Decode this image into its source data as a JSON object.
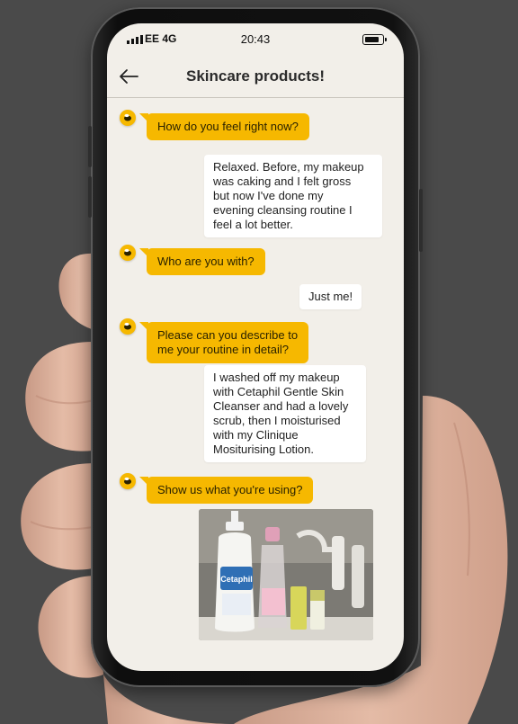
{
  "status": {
    "carrier": "EE 4G",
    "time": "20:43"
  },
  "header": {
    "title": "Skincare products!"
  },
  "messages": [
    {
      "from": "bot",
      "text": "How do you feel right now?"
    },
    {
      "from": "user",
      "lines": [
        "Relaxed. Before, my makeup",
        "was caking and I felt gross",
        "but now I've done my",
        "evening cleansing routine I",
        "feel a lot better."
      ]
    },
    {
      "from": "bot",
      "text": "Who are you with?"
    },
    {
      "from": "user",
      "text": "Just me!"
    },
    {
      "from": "bot",
      "lines": [
        "Please can you describe to",
        "me your routine in detail?"
      ]
    },
    {
      "from": "user",
      "lines": [
        "I washed off my makeup",
        "with Cetaphil Gentle Skin",
        "Cleanser and had a lovely",
        "scrub, then I moisturised",
        "with my Clinique",
        "Mositurising Lotion."
      ]
    },
    {
      "from": "bot",
      "text": "Show us what you're using?"
    }
  ],
  "photo": {
    "bottle_label": "Cetaphil"
  },
  "colors": {
    "background": "#4a4a4a",
    "screen": "#f2efe9",
    "bot_bubble": "#f6b800",
    "user_bubble": "#ffffff"
  }
}
